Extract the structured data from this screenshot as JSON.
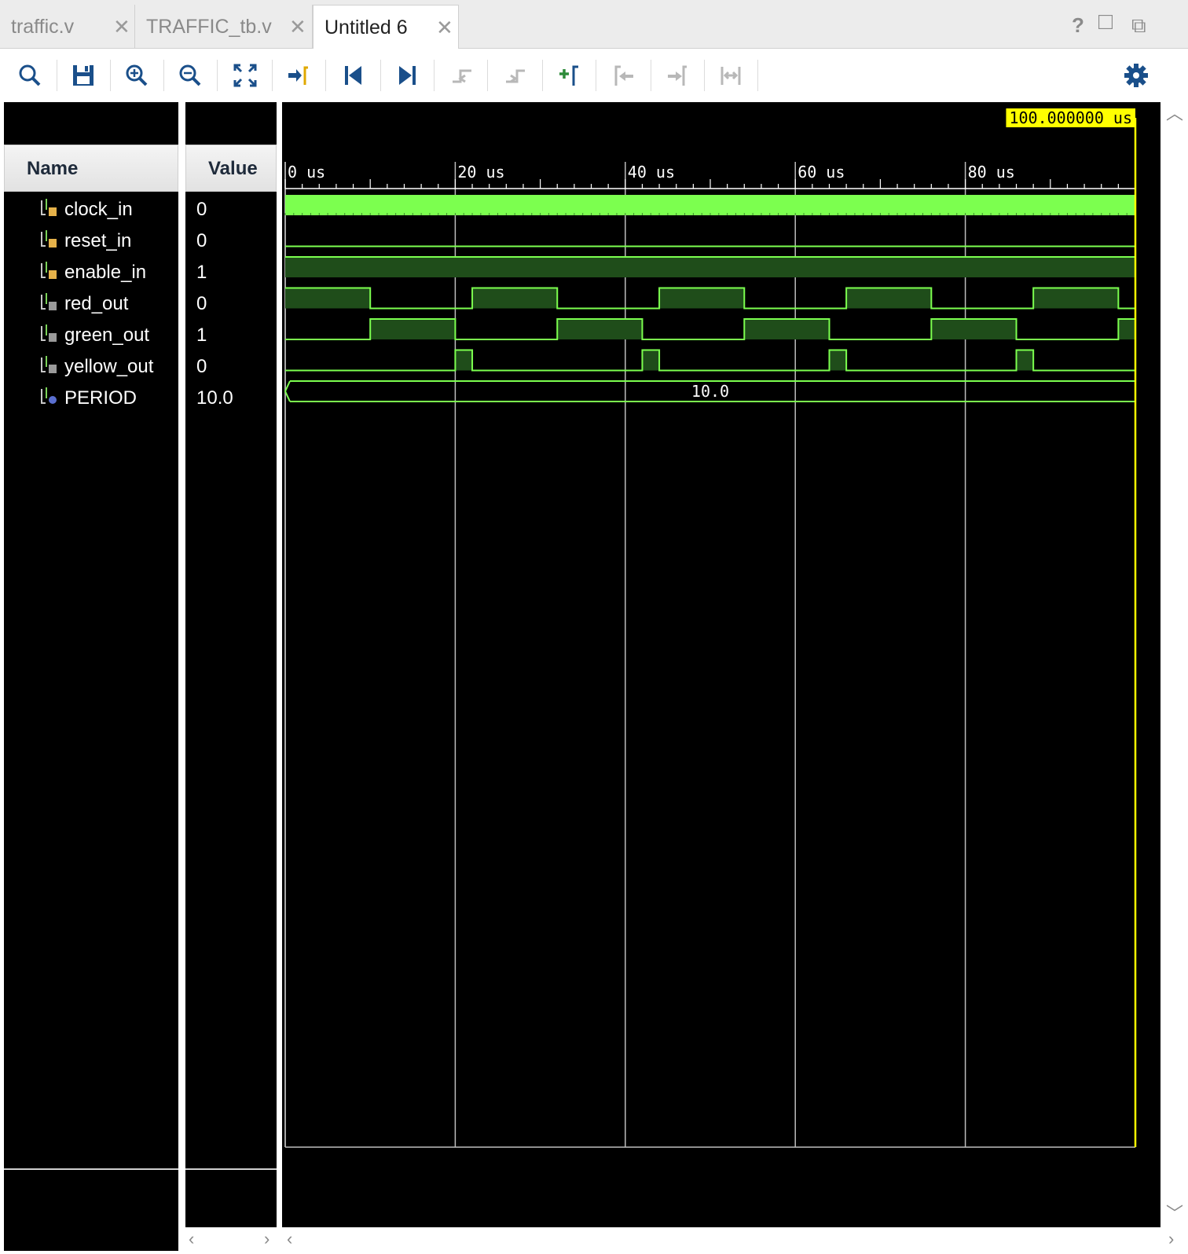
{
  "tabs": [
    {
      "label": "traffic.v",
      "active": false
    },
    {
      "label": "TRAFFIC_tb.v",
      "active": false
    },
    {
      "label": "Untitled 6",
      "active": true
    }
  ],
  "window_controls": {
    "help": "?",
    "maximize": "□",
    "float": "⧉"
  },
  "toolbar": {
    "icons": [
      "search-icon",
      "save-icon",
      "zoom-in-icon",
      "zoom-out-icon",
      "zoom-fit-icon",
      "go-to-cursor-icon",
      "go-to-start-icon",
      "go-to-end-icon",
      "previous-transition-icon",
      "next-transition-icon",
      "add-marker-icon",
      "previous-marker-icon",
      "next-marker-icon",
      "swap-cursors-icon",
      "settings-gear-icon"
    ]
  },
  "columns": {
    "name": "Name",
    "value": "Value"
  },
  "cursor_time": "100.000000 us",
  "signals": [
    {
      "name": "clock_in",
      "value": "0",
      "kind": "in"
    },
    {
      "name": "reset_in",
      "value": "0",
      "kind": "in"
    },
    {
      "name": "enable_in",
      "value": "1",
      "kind": "in"
    },
    {
      "name": "red_out",
      "value": "0",
      "kind": "out"
    },
    {
      "name": "green_out",
      "value": "1",
      "kind": "out"
    },
    {
      "name": "yellow_out",
      "value": "0",
      "kind": "out"
    },
    {
      "name": "PERIOD",
      "value": "10.0",
      "kind": "param"
    }
  ],
  "period_bus_label": "10.0",
  "colors": {
    "wave": "#7cff4f",
    "wave_fill": "#1f4d1a",
    "wave_bg": "#000000",
    "cursor": "#ffff00",
    "grid": "#bdbdbd"
  },
  "chart_data": {
    "type": "waveform",
    "x_unit": "us",
    "x_range": [
      0,
      100
    ],
    "ticks": [
      {
        "t": 0,
        "label": "0 us"
      },
      {
        "t": 20,
        "label": "20 us"
      },
      {
        "t": 40,
        "label": "40 us"
      },
      {
        "t": 60,
        "label": "60 us"
      },
      {
        "t": 80,
        "label": "80 us"
      }
    ],
    "cursor_at": 100,
    "waves": {
      "clock_in": {
        "kind": "clock"
      },
      "reset_in": {
        "kind": "bit",
        "segments": [
          [
            0,
            100,
            0
          ]
        ]
      },
      "enable_in": {
        "kind": "bit",
        "segments": [
          [
            0,
            100,
            1
          ]
        ]
      },
      "red_out": {
        "kind": "bit",
        "segments": [
          [
            0,
            10,
            1
          ],
          [
            10,
            22,
            0
          ],
          [
            22,
            32,
            1
          ],
          [
            32,
            44,
            0
          ],
          [
            44,
            54,
            1
          ],
          [
            54,
            66,
            0
          ],
          [
            66,
            76,
            1
          ],
          [
            76,
            88,
            0
          ],
          [
            88,
            98,
            1
          ],
          [
            98,
            100,
            0
          ]
        ]
      },
      "green_out": {
        "kind": "bit",
        "segments": [
          [
            0,
            10,
            0
          ],
          [
            10,
            20,
            1
          ],
          [
            20,
            32,
            0
          ],
          [
            32,
            42,
            1
          ],
          [
            42,
            54,
            0
          ],
          [
            54,
            64,
            1
          ],
          [
            64,
            76,
            0
          ],
          [
            76,
            86,
            1
          ],
          [
            86,
            98,
            0
          ],
          [
            98,
            100,
            1
          ]
        ]
      },
      "yellow_out": {
        "kind": "bit",
        "segments": [
          [
            0,
            20,
            0
          ],
          [
            20,
            22,
            1
          ],
          [
            22,
            42,
            0
          ],
          [
            42,
            44,
            1
          ],
          [
            44,
            64,
            0
          ],
          [
            64,
            66,
            1
          ],
          [
            66,
            86,
            0
          ],
          [
            86,
            88,
            1
          ],
          [
            88,
            100,
            0
          ]
        ]
      },
      "PERIOD": {
        "kind": "bus",
        "value": "10.0"
      }
    }
  }
}
